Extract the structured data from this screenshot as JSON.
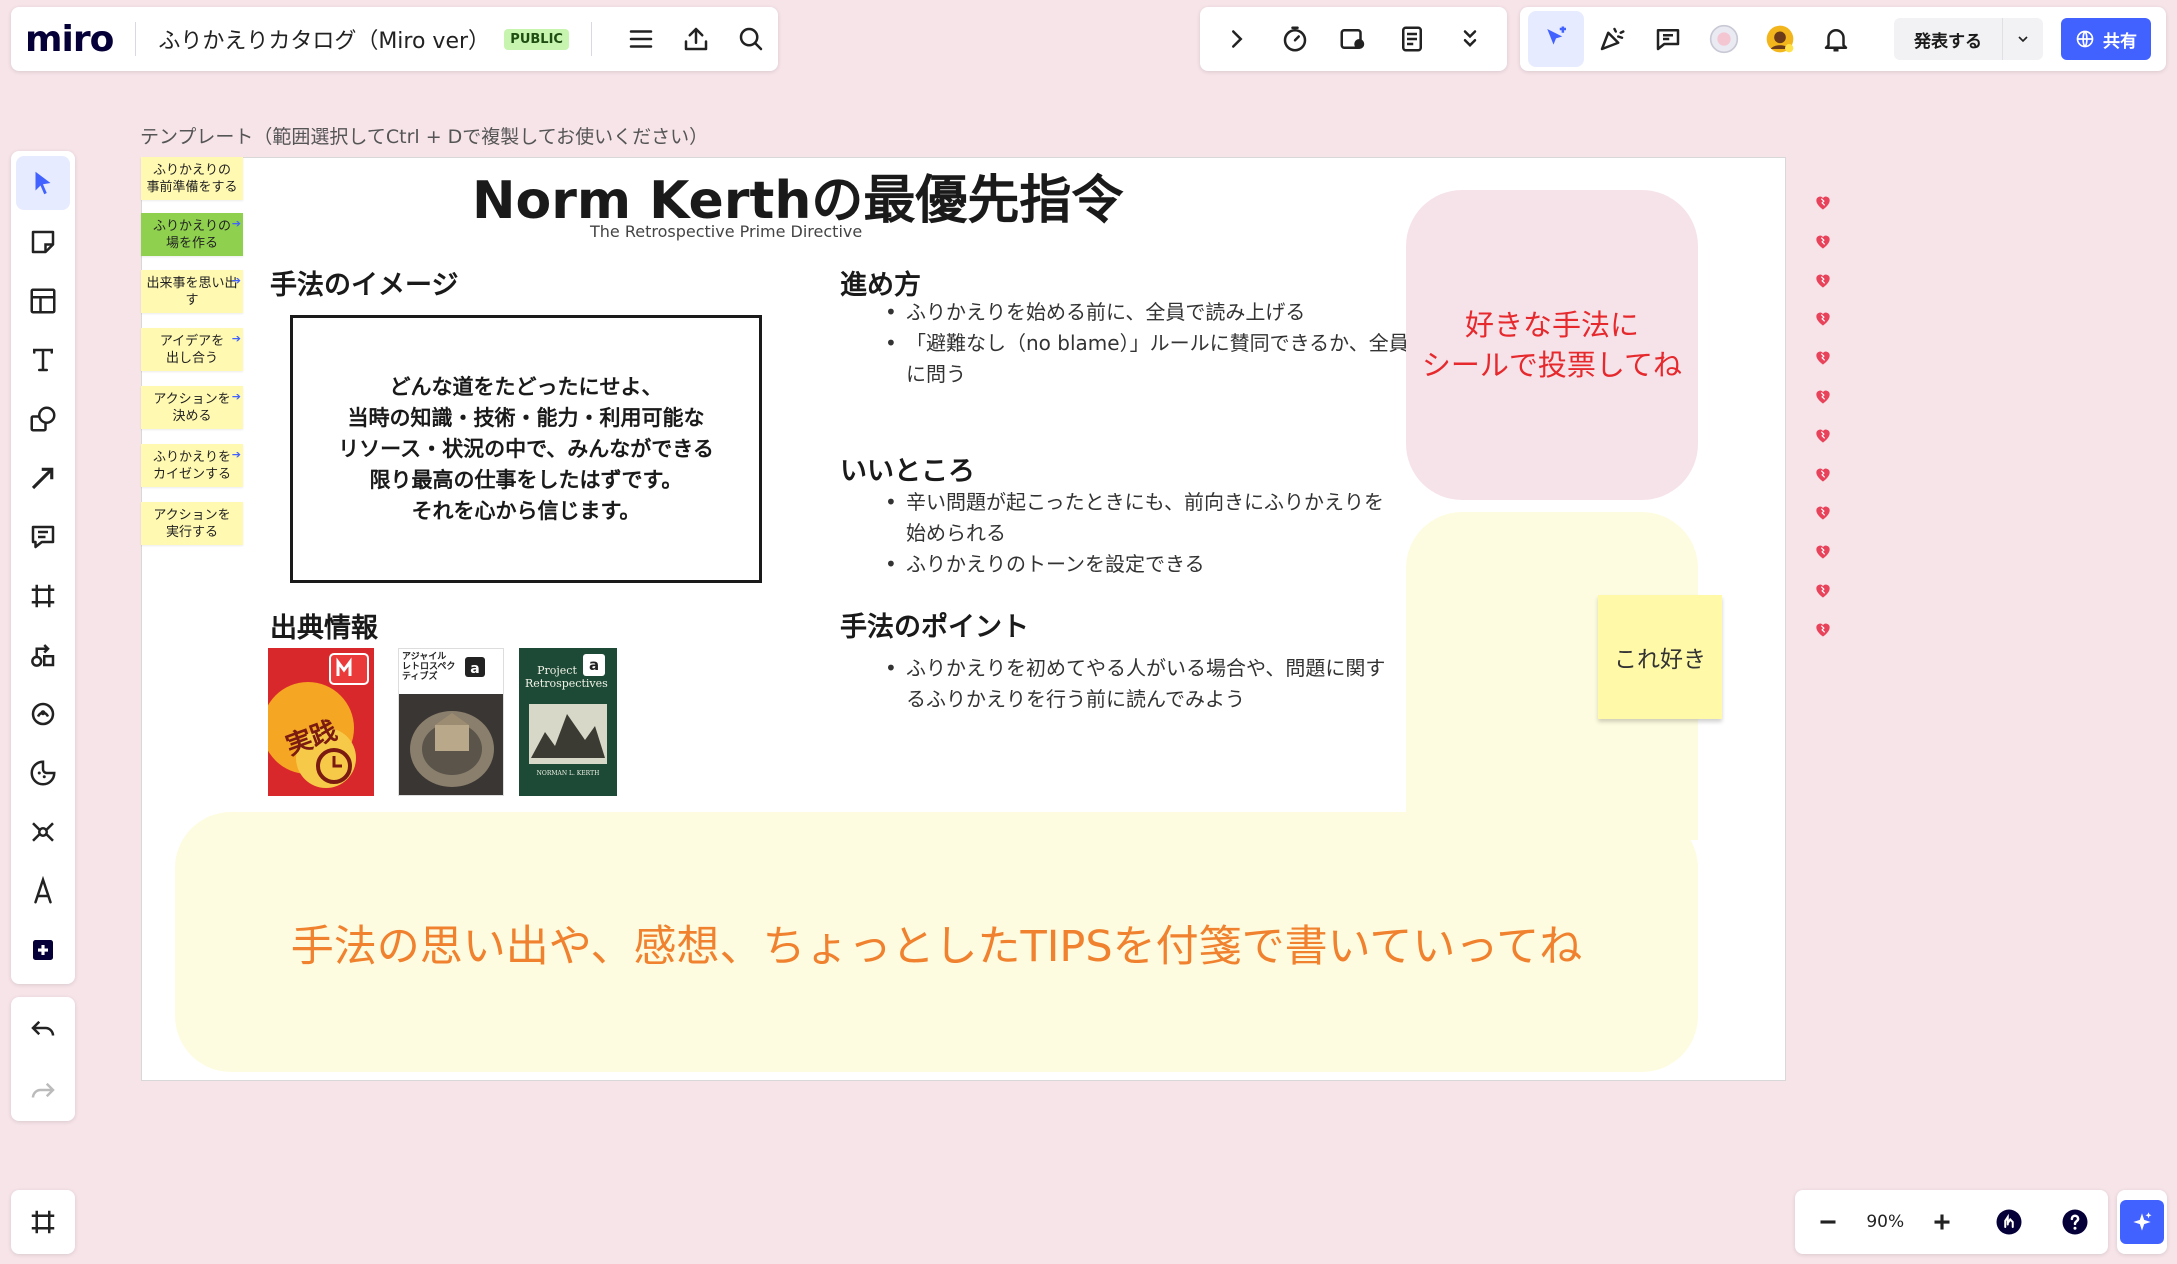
{
  "topbar": {
    "logo": "miro",
    "board_title": "ふりかえりカタログ（Miro ver）",
    "public_badge": "PUBLIC",
    "present_label": "発表する",
    "share_label": "共有"
  },
  "board": {
    "template_label": "テンプレート（範囲選択してCtrl + Dで複製してお使いください）",
    "stickies": [
      "ふりかえりの\n事前準備をする",
      "ふりかえりの\n場を作る",
      "出来事を思い出す",
      "アイデアを\n出し合う",
      "アクションを\n決める",
      "ふりかえりを\nカイゼンする",
      "アクションを\n実行する"
    ],
    "title": "Norm Kerthの最優先指令",
    "subtitle": "The Retrospective Prime Directive",
    "section_image": "手法のイメージ",
    "quote": "どんな道をたどったにせよ、\n当時の知識・技術・能力・利用可能な\nリソース・状況の中で、みんなができる\n限り最高の仕事をしたはずです。\nそれを心から信じます。",
    "section_sources": "出典情報",
    "section_steps": "進め方",
    "steps": [
      "ふりかえりを始める前に、全員で読み上げる",
      "「避難なし（no blame）」ルールに賛同できるか、全員に問う"
    ],
    "section_good": "いいところ",
    "good": [
      "辛い問題が起こったときにも、前向きにふりかえりを始められる",
      "ふりかえりのトーンを設定できる"
    ],
    "section_points": "手法のポイント",
    "points": [
      "ふりかえりを初めてやる人がいる場合や、問題に関するふりかえりを行う前に読んでみよう"
    ],
    "books": {
      "b2_title": "アジャイル\nレトロスペクティブズ",
      "b3_title": "Project\nRetrospectives",
      "b3_author": "NORMAN L. KERTH"
    },
    "vote_text": "好きな手法に\nシールで投票してね",
    "sticky_note": "これ好き",
    "comment_prompt": "手法の思い出や、感想、ちょっとしたTIPSを付箋で書いていってね"
  },
  "zoom": {
    "level": "90%"
  },
  "colors": {
    "accent": "#4262ff",
    "canvas_bg": "#f6e4e9",
    "sticky_yellow": "#fff9b1",
    "sticky_green": "#8fd14f",
    "vote_pink": "#f6e3ea",
    "vote_text": "#e5292d",
    "comment_bg": "#fefce0",
    "comment_text": "#f0812e"
  },
  "icons": {
    "left_toolbar": [
      "select-icon",
      "sticky-note-icon",
      "templates-icon",
      "text-icon",
      "shapes-icon",
      "connector-icon",
      "comment-icon",
      "frame-icon",
      "diagram-icon",
      "miro-ai-icon",
      "stickers-icon",
      "mindmap-icon",
      "pen-icon",
      "more-apps-icon"
    ]
  }
}
